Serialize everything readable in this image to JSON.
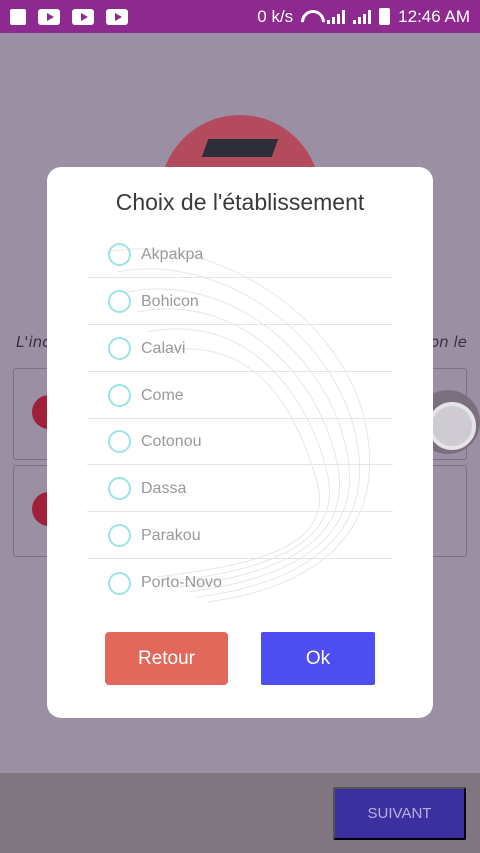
{
  "status_bar": {
    "net_speed": "0 k/s",
    "time": "12:46 AM",
    "icons": [
      "gallery-icon",
      "youtube-icon",
      "youtube-icon",
      "youtube-icon",
      "wifi-icon",
      "signal-icon",
      "signal-icon",
      "battery-icon"
    ]
  },
  "background": {
    "intro_left": "L'inc",
    "intro_right": "on le",
    "next_button": "SUIVANT"
  },
  "dialog": {
    "title": "Choix de l'établissement",
    "options": [
      "Akpakpa",
      "Bohicon",
      "Calavi",
      "Come",
      "Cotonou",
      "Dassa",
      "Parakou",
      "Porto-Novo"
    ],
    "back_button": "Retour",
    "ok_button": "Ok"
  },
  "colors": {
    "status_bar": "#8e2a8f",
    "radio": "#9ee3e6",
    "retour": "#e2685b",
    "ok": "#4d4df0"
  }
}
